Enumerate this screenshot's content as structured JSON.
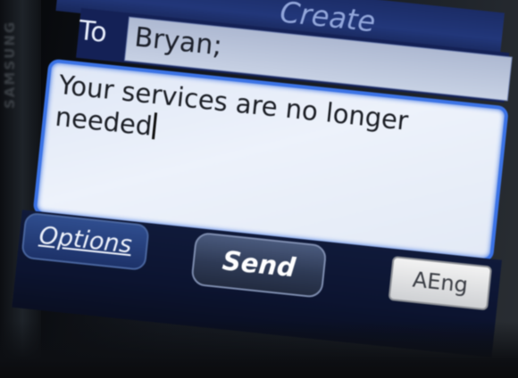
{
  "device": {
    "brand": "SAMSUNG"
  },
  "header": {
    "title": "Create"
  },
  "recipient": {
    "label": "To",
    "value": "Bryan;"
  },
  "message": {
    "text": "Your services are no longer needed"
  },
  "softkeys": {
    "options_label": "Options",
    "send_label": "Send",
    "input_mode_label": "AEng"
  },
  "colors": {
    "title_bar": "#22377a",
    "field_border": "#3b73e6",
    "softkey_bar": "#0c1430"
  }
}
